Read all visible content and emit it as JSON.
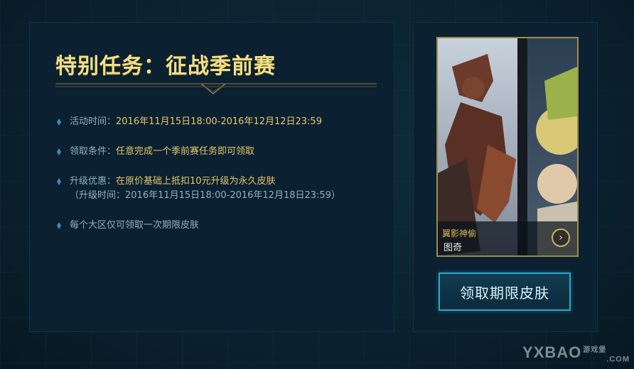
{
  "task": {
    "title": "特别任务：征战季前赛",
    "items": [
      {
        "label": "活动时间：",
        "value": "2016年11月15日18:00-2016年12月12日23:59"
      },
      {
        "label": "领取条件：",
        "value": "任意完成一个季前赛任务即可领取"
      },
      {
        "label": "升级优惠：",
        "value": "在原价基础上抵扣10元升级为永久皮肤",
        "sub": "（升级时间：2016年11月15日18:00-2016年12月18日23:59）"
      },
      {
        "label": "每个大区仅可领取一次期限皮肤",
        "value": ""
      }
    ]
  },
  "skin": {
    "name": "翼影神偷",
    "hero": "图奇",
    "next_label": "›"
  },
  "claim_button": "领取期限皮肤",
  "watermark": {
    "brand": "YXBAO",
    "cn": "游戏堡",
    "domain": ".COM"
  },
  "colors": {
    "accent_gold": "#f0df8a",
    "value_gold": "#e6c76c",
    "label_blue": "#8fb3c2",
    "button_border": "#2aa9c9"
  }
}
